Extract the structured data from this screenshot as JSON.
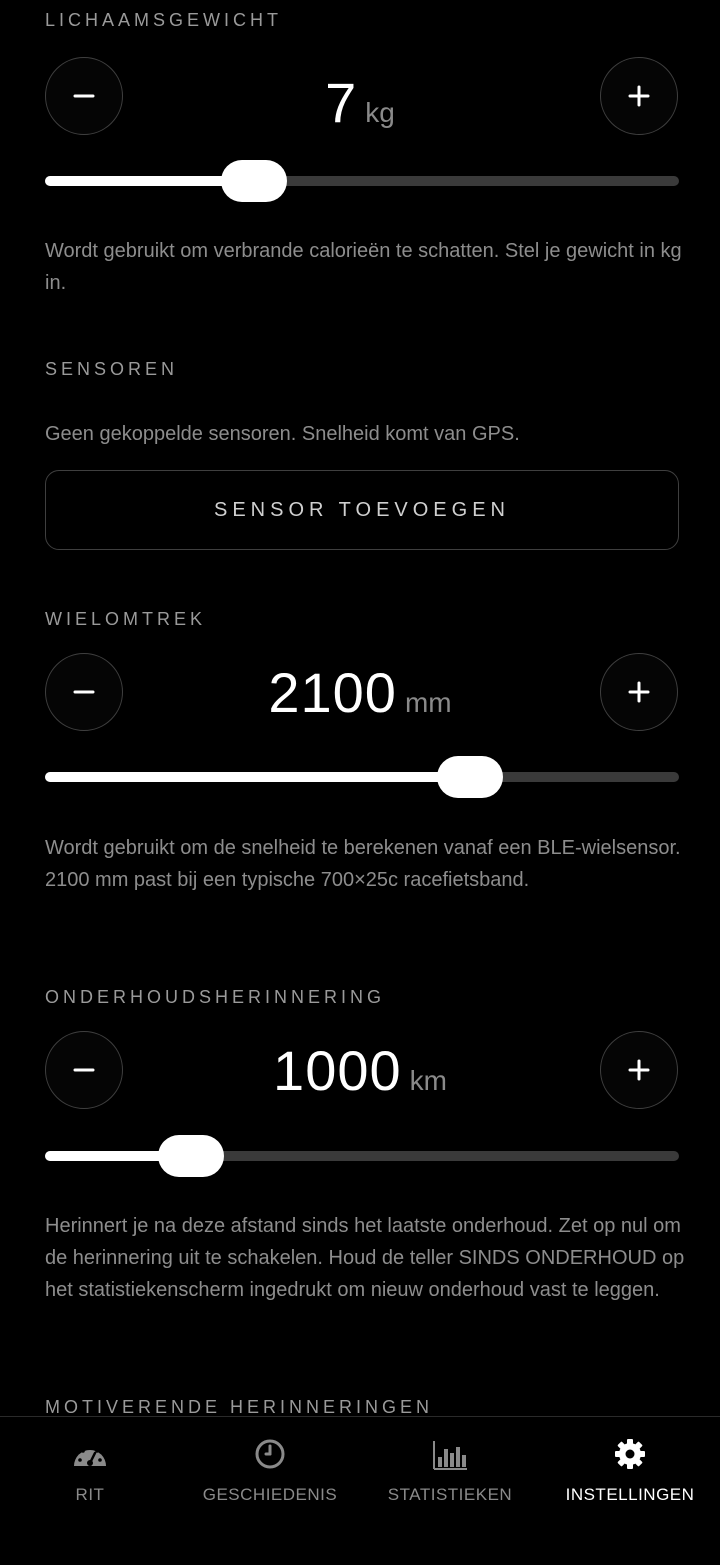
{
  "weight": {
    "label": "LICHAAMSGEWICHT",
    "value": "7",
    "unit": "kg",
    "slider_fraction": 0.33,
    "description": "Wordt gebruikt om verbrande calorieën te schatten. Stel je gewicht in kg in."
  },
  "sensors": {
    "label": "SENSOREN",
    "description": "Geen gekoppelde sensoren. Snelheid komt van GPS.",
    "add_button": "SENSOR TOEVOEGEN"
  },
  "wheel": {
    "label": "WIELOMTREK",
    "value": "2100",
    "unit": "mm",
    "slider_fraction": 0.67,
    "description": "Wordt gebruikt om de snelheid te berekenen vanaf een BLE-wielsensor. 2100 mm past bij een typische 700×25c racefietsband."
  },
  "maintenance": {
    "label": "ONDERHOUDSHERINNERING",
    "value": "1000",
    "unit": "km",
    "slider_fraction": 0.23,
    "description": "Herinnert je na deze afstand sinds het laatste onderhoud. Zet op nul om de herinnering uit te schakelen. Houd de teller SINDS ONDERHOUD op het statistiekenscherm ingedrukt om nieuw onderhoud vast te leggen."
  },
  "motivation": {
    "label": "MOTIVERENDE HERINNERINGEN"
  },
  "tabs": [
    {
      "label": "RIT",
      "icon": "speedometer-icon",
      "active": false
    },
    {
      "label": "GESCHIEDENIS",
      "icon": "clock-icon",
      "active": false
    },
    {
      "label": "STATISTIEKEN",
      "icon": "bar-chart-icon",
      "active": false
    },
    {
      "label": "INSTELLINGEN",
      "icon": "gear-icon",
      "active": true
    }
  ],
  "colors": {
    "background": "#000000",
    "active": "#ffffff",
    "inactive": "#8a8a8a"
  }
}
